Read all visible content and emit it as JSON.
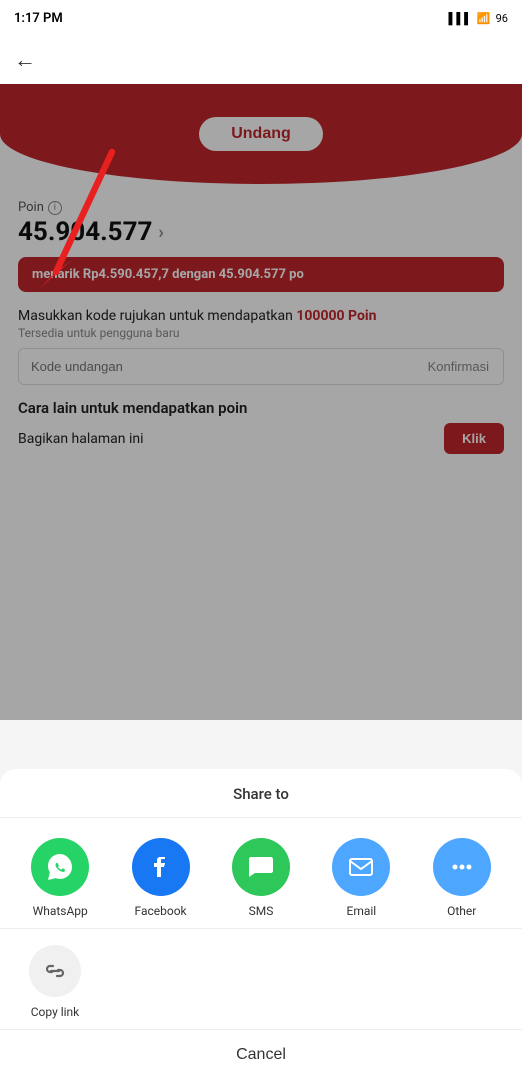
{
  "statusBar": {
    "time": "1:17 PM",
    "icons": "📶 🔋96"
  },
  "topBar": {
    "backLabel": "←"
  },
  "mainContent": {
    "undangLabel": "Undang",
    "poinLabel": "Poin",
    "poinValue": "45.904.577",
    "poinChevron": "›",
    "promoBanner": "menarik Rp4.590.457,7 dengan 45.904.577 po",
    "referralTitle": "Masukkan kode rujukan untuk mendapatkan",
    "referralPoin": "100000 Poin",
    "referralSub": "Tersedia untuk pengguna baru",
    "referralPlaceholder": "Kode undangan",
    "confirmLabel": "Konfirmasi",
    "caraLain": "Cara lain untuk mendapatkan poin",
    "bagikanLabel": "Bagikan halaman ini",
    "klikLabel": "Klik"
  },
  "shareSheet": {
    "title": "Share to",
    "icons": [
      {
        "id": "whatsapp",
        "label": "WhatsApp",
        "colorClass": "icon-whatsapp",
        "symbol": "💬"
      },
      {
        "id": "facebook",
        "label": "Facebook",
        "colorClass": "icon-facebook",
        "symbol": "f"
      },
      {
        "id": "sms",
        "label": "SMS",
        "colorClass": "icon-sms",
        "symbol": "💬"
      },
      {
        "id": "email",
        "label": "Email",
        "colorClass": "icon-email",
        "symbol": "✉"
      },
      {
        "id": "other",
        "label": "Other",
        "colorClass": "icon-other",
        "symbol": "···"
      }
    ],
    "copyLabel": "Copy link",
    "cancelLabel": "Cancel"
  }
}
